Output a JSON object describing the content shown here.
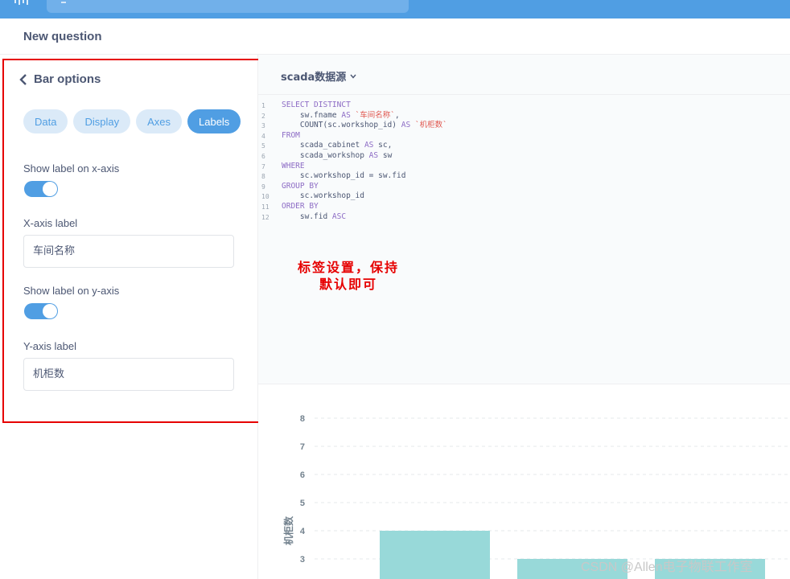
{
  "header": {
    "title": "New question"
  },
  "sidebar": {
    "back_label": "Bar options",
    "tabs": [
      {
        "label": "Data",
        "active": false
      },
      {
        "label": "Display",
        "active": false
      },
      {
        "label": "Axes",
        "active": false
      },
      {
        "label": "Labels",
        "active": true
      }
    ],
    "x_label_toggle": {
      "label": "Show label on x-axis",
      "on": true
    },
    "x_axis_label": {
      "label": "X-axis label",
      "value": "车间名称"
    },
    "y_label_toggle": {
      "label": "Show label on y-axis",
      "on": true
    },
    "y_axis_label": {
      "label": "Y-axis label",
      "value": "机柜数"
    }
  },
  "editor": {
    "source": "scada数据源",
    "line_numbers": [
      "1",
      "2",
      "3",
      "4",
      "5",
      "6",
      "7",
      "8",
      "9",
      "10",
      "11",
      "12"
    ],
    "lines": [
      [
        [
          "kw",
          "SELECT DISTINCT"
        ]
      ],
      [
        [
          "txt",
          "    sw.fname "
        ],
        [
          "kw",
          "AS"
        ],
        [
          "str",
          " `车间名称`"
        ],
        [
          "txt",
          ","
        ]
      ],
      [
        [
          "txt",
          "    COUNT(sc.workshop_id) "
        ],
        [
          "kw",
          "AS"
        ],
        [
          "str",
          " `机柜数`"
        ]
      ],
      [
        [
          "kw",
          "FROM"
        ]
      ],
      [
        [
          "txt",
          "    scada_cabinet "
        ],
        [
          "kw",
          "AS"
        ],
        [
          "txt",
          " sc,"
        ]
      ],
      [
        [
          "txt",
          "    scada_workshop "
        ],
        [
          "kw",
          "AS"
        ],
        [
          "txt",
          " sw"
        ]
      ],
      [
        [
          "kw",
          "WHERE"
        ]
      ],
      [
        [
          "txt",
          "    sc.workshop_id = sw.fid"
        ]
      ],
      [
        [
          "kw",
          "GROUP BY"
        ]
      ],
      [
        [
          "txt",
          "    sc.workshop_id"
        ]
      ],
      [
        [
          "kw",
          "ORDER BY"
        ]
      ],
      [
        [
          "txt",
          "    sw.fid "
        ],
        [
          "kw",
          "ASC"
        ]
      ]
    ]
  },
  "annotation": {
    "line1": "标签设置，保持",
    "line2": "默认即可"
  },
  "chart_data": {
    "type": "bar",
    "ylabel": "机柜数",
    "yticks": [
      3,
      4,
      5,
      6,
      7,
      8
    ],
    "values": [
      4,
      3,
      3
    ],
    "colors": {
      "bar": "#98d9d9",
      "grid": "#e6e8eb",
      "tick": "#74838f"
    }
  },
  "watermark": "CSDN @Allen电子物联工作室"
}
